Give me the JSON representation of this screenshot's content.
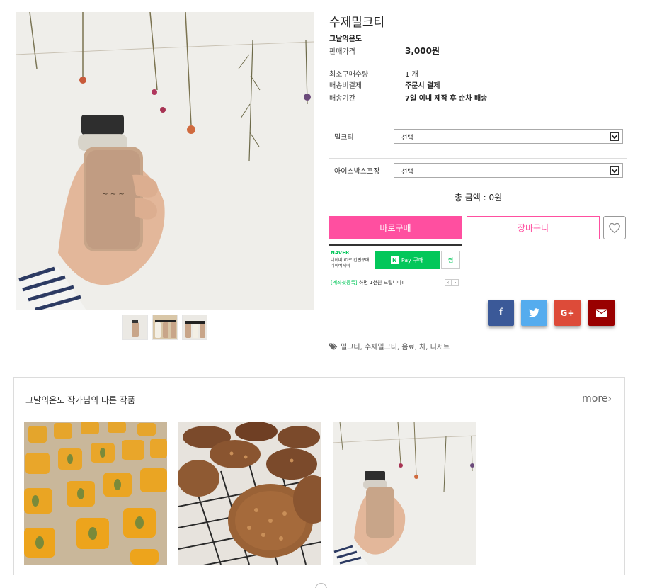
{
  "product": {
    "title": "수제밀크티",
    "maker": "그날의온도",
    "price_label": "판매가격",
    "price_value": "3,000원",
    "min_qty_label": "최소구매수량",
    "min_qty_value": "1 개",
    "ship_pay_label": "배송비결제",
    "ship_pay_value": "주문시 결제",
    "ship_period_label": "배송기간",
    "ship_period_value": "7일 이내 제작 후 순차 배송"
  },
  "options": [
    {
      "label": "밀크티",
      "value": "선택"
    },
    {
      "label": "아이스박스포장",
      "value": "선택"
    }
  ],
  "total": "총 금액 : 0원",
  "buttons": {
    "buy": "바로구매",
    "cart": "장바구니"
  },
  "npay": {
    "brand": "NAVER",
    "line1": "네이버 ID로 간편구매",
    "line2": "네이버페이",
    "pay_label": "Pay 구매",
    "n_mark": "N",
    "wish": "찜",
    "promo_highlight": "[계좌첫등록]",
    "promo_rest": "하면 1천원 드립니다!"
  },
  "share": {
    "facebook": "f",
    "google": "G+"
  },
  "tags": "밀크티, 수제밀크티, 음료, 차, 디저트",
  "other_works": {
    "title": "그날의온도 작가님의 다른 작품",
    "more": "more›"
  },
  "colors": {
    "accent_pink": "#ff4fa0",
    "price_red": "#e8345e",
    "naver_green": "#03c75a"
  },
  "icons": [
    "heart-icon",
    "facebook-icon",
    "twitter-icon",
    "google-plus-icon",
    "envelope-icon",
    "tag-icon",
    "chevron-down-icon"
  ]
}
